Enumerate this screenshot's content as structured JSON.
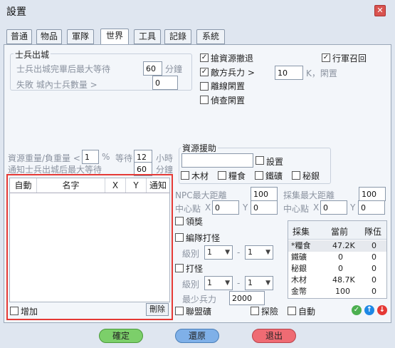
{
  "window": {
    "title": "設置"
  },
  "tabs": [
    {
      "label": "普通"
    },
    {
      "label": "物品"
    },
    {
      "label": "軍隊"
    },
    {
      "label": "世界",
      "active": true
    },
    {
      "label": "工具"
    },
    {
      "label": "記錄"
    },
    {
      "label": "系統"
    }
  ],
  "soldier": {
    "group_title": "士兵出城",
    "max_wait_label": "士兵出城完畢后最大等待",
    "max_wait_value": "60",
    "max_wait_unit": "分鐘",
    "fail_label": "失敗 城內士兵數量 >",
    "fail_value": "0"
  },
  "right_checks": {
    "grab_resources": {
      "label": "搶資源撤退",
      "checked": true
    },
    "march_recall": {
      "label": "行軍召回",
      "checked": true
    },
    "enemy_force": {
      "label": "敵方兵力 >",
      "checked": true,
      "value": "10",
      "unit": "K，閑置"
    },
    "offline_idle": {
      "label": "離線閑置",
      "checked": false
    },
    "scout_idle": {
      "label": "偵查閑置",
      "checked": false
    }
  },
  "resource_weight": {
    "label": "資源重量/負重量 <",
    "value": "1",
    "unit": "%",
    "wait_label": "等待",
    "wait_value": "12",
    "wait_unit": "小時"
  },
  "notify_soldier": {
    "label": "通知士兵出城后最大等待",
    "value": "60",
    "unit": "分鐘"
  },
  "table": {
    "columns": [
      "自動",
      "名字",
      "X",
      "Y",
      "通知"
    ],
    "add_label": "增加",
    "delete_label": "刪除"
  },
  "resource_aid": {
    "group_title": "資源援助",
    "input_value": "",
    "setting_label": "設置",
    "types": [
      {
        "label": "木材",
        "checked": false
      },
      {
        "label": "糧食",
        "checked": false
      },
      {
        "label": "鐵礦",
        "checked": false
      },
      {
        "label": "秘銀",
        "checked": false
      }
    ]
  },
  "npc": {
    "max_dist_label": "NPC最大距離",
    "max_dist_value": "100",
    "center_label": "中心點",
    "x_label": "X",
    "x_value": "0",
    "y_label": "Y",
    "y_value": "0"
  },
  "gather": {
    "max_dist_label": "採集最大距離",
    "max_dist_value": "100",
    "center_label": "中心點",
    "x_label": "X",
    "x_value": "0",
    "y_label": "Y",
    "y_value": "0"
  },
  "claim_reward": {
    "label": "領獎",
    "checked": false
  },
  "team_fight": {
    "label": "編隊打怪",
    "checked": false,
    "level_label": "級別",
    "from": "1",
    "dash": "-",
    "to": "1"
  },
  "fight": {
    "label": "打怪",
    "checked": false,
    "level_label": "級別",
    "from": "1",
    "dash": "-",
    "to": "1",
    "min_force_label": "最少兵力",
    "min_force_value": "2000"
  },
  "stats": {
    "headers": [
      "採集",
      "當前",
      "隊伍"
    ],
    "rows": [
      {
        "name": "*糧食",
        "current": "47.2K",
        "team": "0"
      },
      {
        "name": "鐵礦",
        "current": "0",
        "team": "0"
      },
      {
        "name": "秘銀",
        "current": "0",
        "team": "0"
      },
      {
        "name": "木材",
        "current": "48.7K",
        "team": "0"
      },
      {
        "name": "金幣",
        "current": "100",
        "team": "0"
      }
    ]
  },
  "bottom_checks": {
    "alliance_mine": {
      "label": "聯盟礦",
      "checked": false
    },
    "explore": {
      "label": "探險",
      "checked": false
    },
    "auto": {
      "label": "自動",
      "checked": false
    }
  },
  "buttons": {
    "confirm": "確定",
    "restore": "還原",
    "exit": "退出"
  },
  "colors": {
    "confirm": "#7ccf6a",
    "restore": "#7fb0e8",
    "exit": "#ef6b73",
    "highlight": "#e53935"
  }
}
